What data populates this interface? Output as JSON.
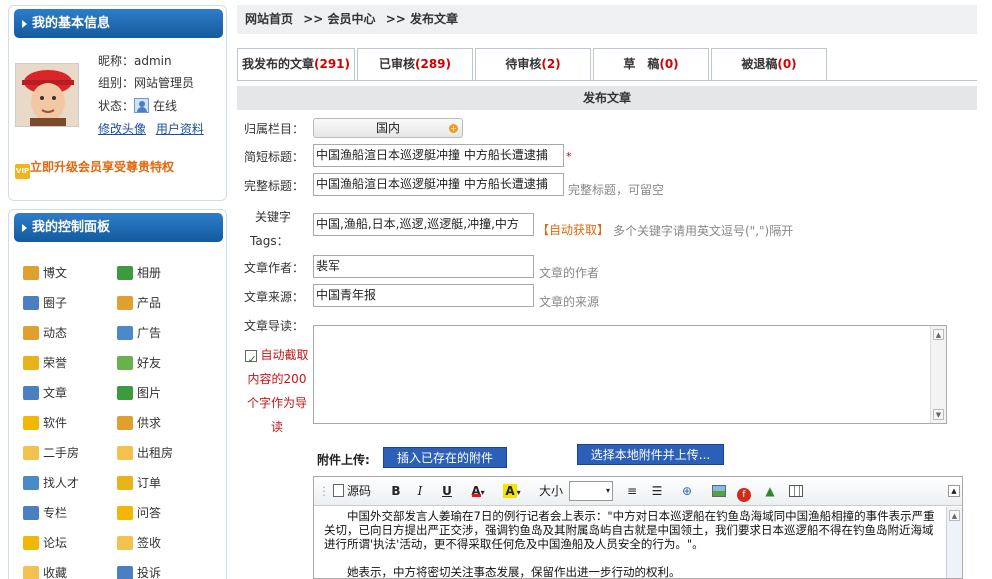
{
  "sidebar": {
    "profile": {
      "title": "我的基本信息",
      "nickname_label": "昵称：",
      "nickname": "admin",
      "group_label": "组别：",
      "group": "网站管理员",
      "status_label": "状态：",
      "status": "在线",
      "edit_avatar": "修改头像",
      "user_info": "用户资料",
      "upgrade": "立即升级会员享受尊贵特权"
    },
    "control_panel": {
      "title": "我的控制面板",
      "items": [
        {
          "label": "博文",
          "icon": "pencil-icon"
        },
        {
          "label": "相册",
          "icon": "photo-icon"
        },
        {
          "label": "圈子",
          "icon": "group-icon"
        },
        {
          "label": "产品",
          "icon": "tag-icon"
        },
        {
          "label": "动态",
          "icon": "megaphone-icon"
        },
        {
          "label": "广告",
          "icon": "ad-icon"
        },
        {
          "label": "荣誉",
          "icon": "crown-icon"
        },
        {
          "label": "好友",
          "icon": "friend-icon"
        },
        {
          "label": "文章",
          "icon": "article-icon"
        },
        {
          "label": "图片",
          "icon": "image-icon"
        },
        {
          "label": "软件",
          "icon": "software-icon"
        },
        {
          "label": "供求",
          "icon": "supply-icon"
        },
        {
          "label": "二手房",
          "icon": "folder-icon"
        },
        {
          "label": "出租房",
          "icon": "folder-icon"
        },
        {
          "label": "找人才",
          "icon": "talent-icon"
        },
        {
          "label": "订单",
          "icon": "order-icon"
        },
        {
          "label": "专栏",
          "icon": "column-icon"
        },
        {
          "label": "问答",
          "icon": "qa-icon"
        },
        {
          "label": "论坛",
          "icon": "forum-icon"
        },
        {
          "label": "签收",
          "icon": "folder-icon"
        },
        {
          "label": "收藏",
          "icon": "folder-icon"
        },
        {
          "label": "投诉",
          "icon": "complaint-icon"
        }
      ]
    }
  },
  "breadcrumb": {
    "home": "网站首页",
    "sep1": ">>",
    "member": "会员中心",
    "sep2": ">>",
    "current": "发布文章"
  },
  "tabs": [
    {
      "label": "我发布的文章",
      "count": "(291)"
    },
    {
      "label": "已审核",
      "count": "(289)"
    },
    {
      "label": "待审核",
      "count": "(2)"
    },
    {
      "label": "草　稿",
      "count": "(0)"
    },
    {
      "label": "被退稿",
      "count": "(0)"
    }
  ],
  "form": {
    "section_title": "发布文章",
    "category_label": "归属栏目：",
    "category_value": "国内",
    "short_title_label": "简短标题：",
    "short_title_value": "中国渔船渲日本巡逻艇冲撞 中方船长遭逮捕",
    "required_mark": "*",
    "full_title_label": "完整标题：",
    "full_title_value": "中国渔船渲日本巡逻艇冲撞 中方船长遭逮捕",
    "full_title_hint": "完整标题，可留空",
    "keywords_label_1": "关键字",
    "keywords_label_2": "Tags：",
    "keywords_value": "中国,渔船,日本,巡逻,巡逻艇,冲撞,中方",
    "auto_fetch": "【自动获取】",
    "keywords_hint": "多个关键字请用英文逗号(\",\")隔开",
    "author_label": "文章作者：",
    "author_value": "裴军",
    "author_hint": "文章的作者",
    "source_label": "文章来源：",
    "source_value": "中国青年报",
    "source_hint": "文章的来源",
    "intro_label": "文章导读：",
    "auto_cut": "自动截取内容的200个字作为导读",
    "upload_label": "附件上传:",
    "insert_existing": "插入已存在的附件",
    "select_local": "选择本地附件并上传..."
  },
  "editor": {
    "source_label": "源码",
    "size_label": "大小",
    "paragraph_1": "中国外交部发言人姜瑜在7日的例行记者会上表示：\"中方对日本巡逻船在钓鱼岛海域同中国渔船相撞的事件表示严重关切，已向日方提出严正交涉，强调钓鱼岛及其附属岛屿自古就是中国领土，我们要求日本巡逻船不得在钓鱼岛附近海域进行所谓'执法'活动，更不得采取任何危及中国渔船及人员安全的行为。\"。",
    "paragraph_2": "她表示，中方将密切关注事态发展，保留作出进一步行动的权利。"
  }
}
